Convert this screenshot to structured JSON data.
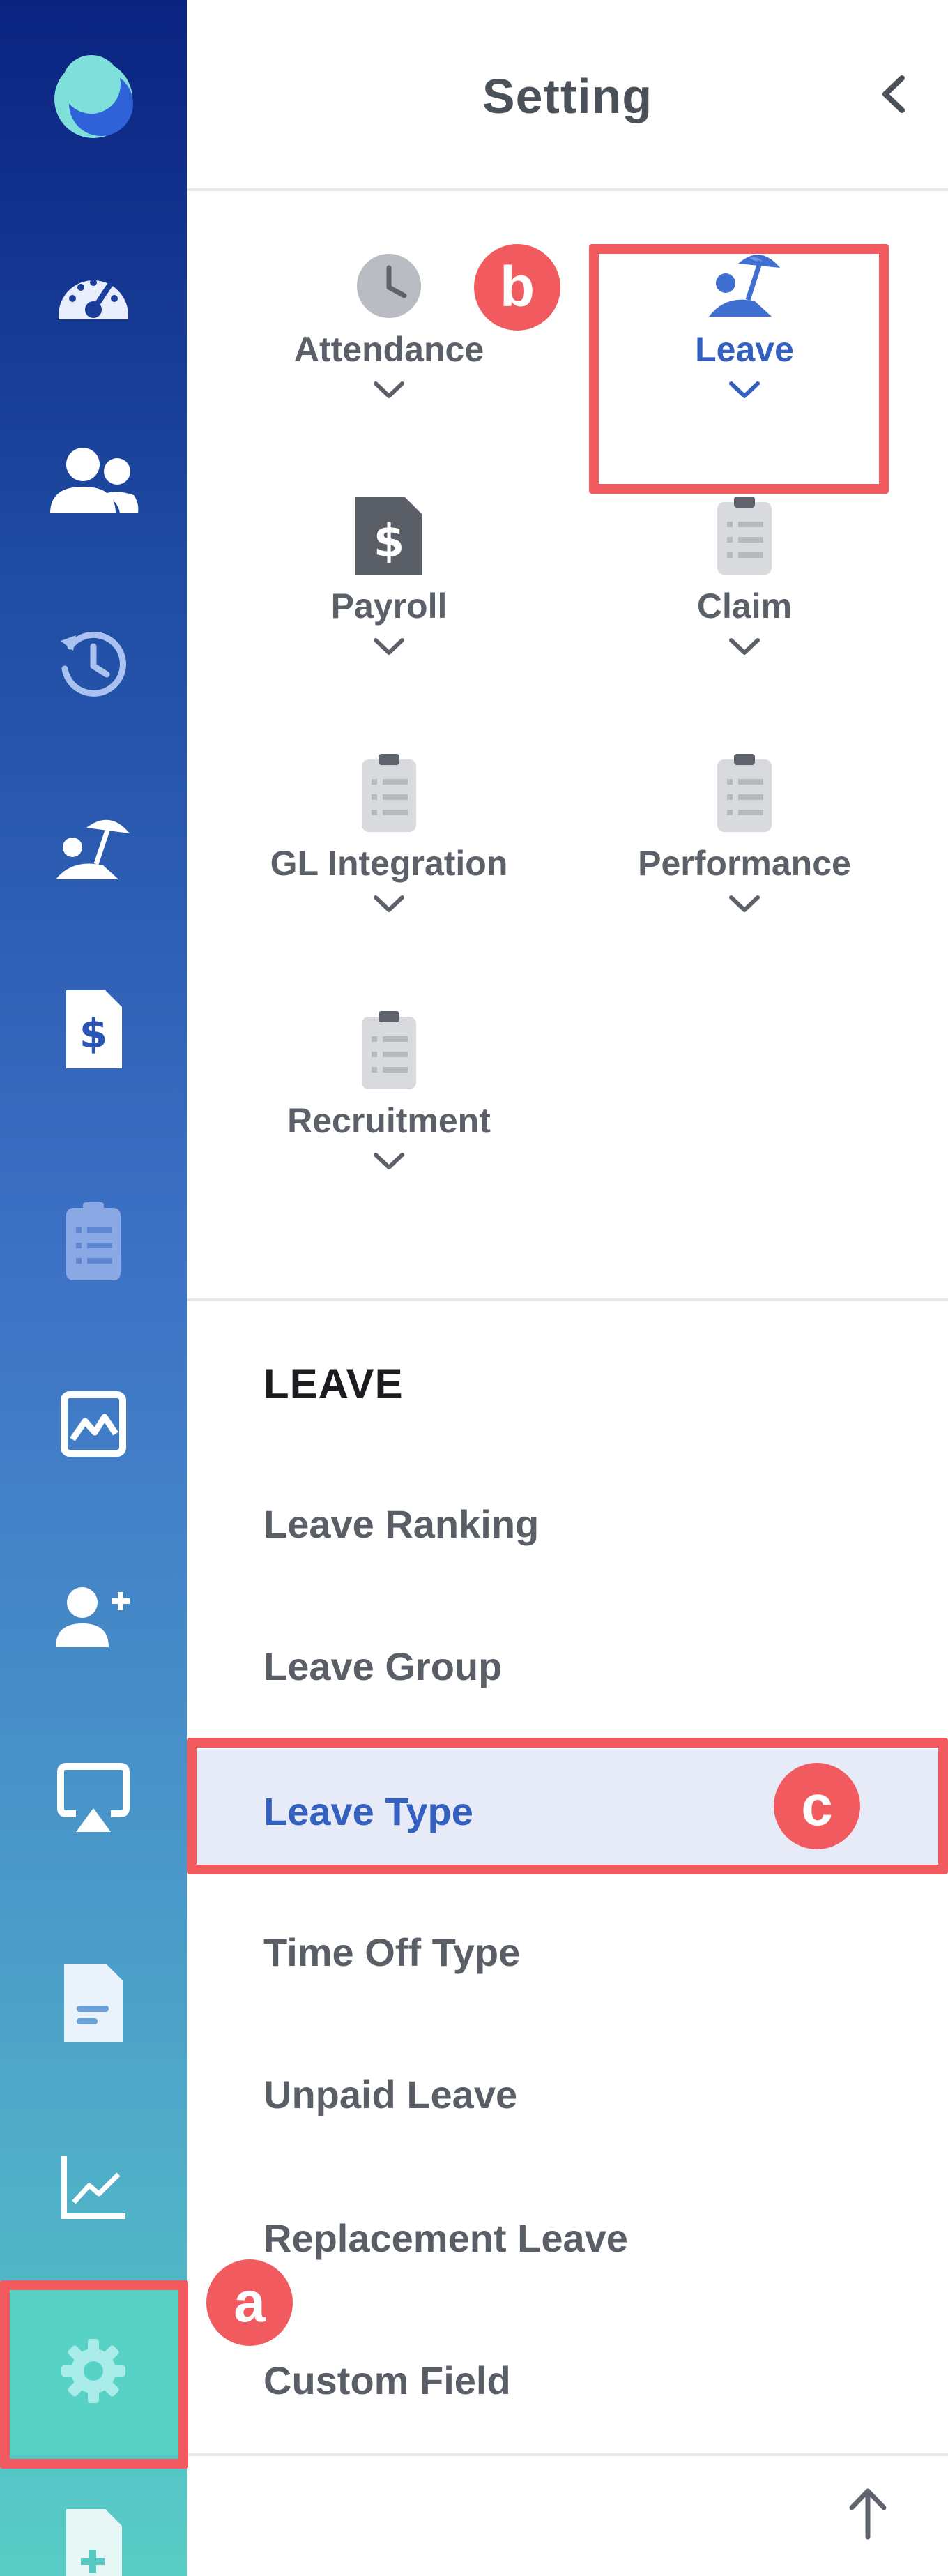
{
  "panel": {
    "title": "Setting",
    "modules": [
      {
        "label": "Attendance",
        "icon": "clock-icon"
      },
      {
        "label": "Leave",
        "icon": "beach-umbrella-icon",
        "selected": true
      },
      {
        "label": "Payroll",
        "icon": "dollar-document-icon"
      },
      {
        "label": "Claim",
        "icon": "clipboard-icon"
      },
      {
        "label": "GL Integration",
        "icon": "clipboard-icon"
      },
      {
        "label": "Performance",
        "icon": "clipboard-icon"
      },
      {
        "label": "Recruitment",
        "icon": "clipboard-icon"
      }
    ]
  },
  "section": {
    "title": "LEAVE",
    "items": [
      {
        "label": "Leave Ranking"
      },
      {
        "label": "Leave Group"
      },
      {
        "label": "Leave Type",
        "active": true
      },
      {
        "label": "Time Off Type"
      },
      {
        "label": "Unpaid Leave"
      },
      {
        "label": "Replacement Leave"
      },
      {
        "label": "Custom Field"
      }
    ]
  },
  "rail": {
    "items": [
      {
        "icon": "app-logo-icon"
      },
      {
        "icon": "dashboard-speedometer-icon"
      },
      {
        "icon": "people-icon"
      },
      {
        "icon": "history-clock-icon"
      },
      {
        "icon": "beach-umbrella-icon"
      },
      {
        "icon": "dollar-document-icon"
      },
      {
        "icon": "clipboard-icon"
      },
      {
        "icon": "chart-image-icon"
      },
      {
        "icon": "add-user-icon"
      },
      {
        "icon": "screen-share-icon"
      },
      {
        "icon": "document-icon"
      },
      {
        "icon": "line-chart-icon"
      },
      {
        "icon": "gear-icon",
        "active": true
      },
      {
        "icon": "add-document-icon"
      }
    ]
  },
  "annotations": {
    "a": "a",
    "b": "b",
    "c": "c",
    "color": "#f15b5f"
  },
  "colors": {
    "accent": "#3461c0",
    "active_row_bg": "#e6ebf7",
    "rail_top": "#0a2380",
    "rail_bottom": "#58cdc5",
    "rail_active": "#57d2c5"
  }
}
